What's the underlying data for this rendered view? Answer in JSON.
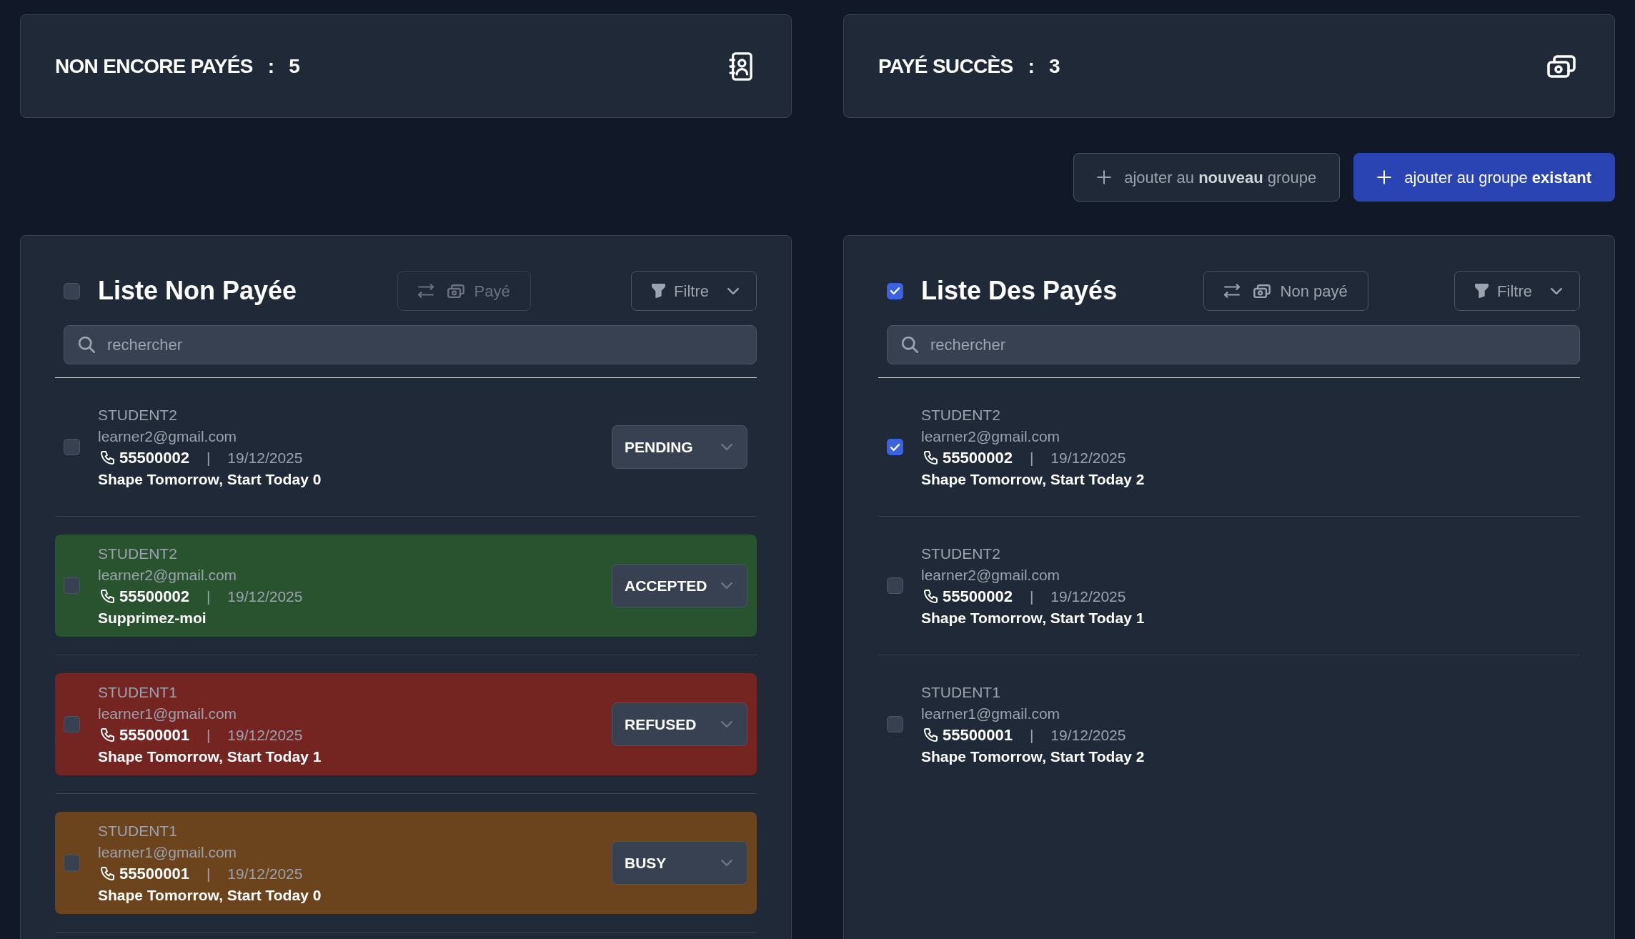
{
  "summary_cards": [
    {
      "kind": "unpaid",
      "label": "NON ENCORE PAYÉS",
      "separator": ":",
      "count": "5"
    },
    {
      "kind": "paid",
      "label": "PAYÉ SUCCÈS",
      "separator": ":",
      "count": "3"
    }
  ],
  "group_buttons": [
    {
      "kind": "secondary",
      "label": "ajouter au **nouveau** groupe"
    },
    {
      "kind": "primary",
      "label": "ajouter au groupe **existant**"
    }
  ],
  "lists": [
    {
      "all_checked": false,
      "title": "Liste Non Payée",
      "move_button": {
        "label": "Payé",
        "disabled": true
      },
      "filter_button": {
        "label": "Filtre"
      },
      "search": {
        "placeholder": "rechercher"
      },
      "more_below": true,
      "items": [
        {
          "checked": false,
          "name": "STUDENT2",
          "email": "learner2@gmail.com",
          "phone": "55500002",
          "separator": "|",
          "date": "19/12/2025",
          "subtitle": "Shape Tomorrow, Start Today 0",
          "status": "PENDING"
        },
        {
          "checked": false,
          "color": "#29532f",
          "name": "STUDENT2",
          "email": "learner2@gmail.com",
          "phone": "55500002",
          "separator": "|",
          "date": "19/12/2025",
          "subtitle": "Supprimez-moi",
          "status": "ACCEPTED"
        },
        {
          "checked": false,
          "color": "#742522",
          "name": "STUDENT1",
          "email": "learner1@gmail.com",
          "phone": "55500001",
          "separator": "|",
          "date": "19/12/2025",
          "subtitle": "Shape Tomorrow, Start Today 1",
          "status": "REFUSED"
        },
        {
          "checked": false,
          "color": "#6b431d",
          "name": "STUDENT1",
          "email": "learner1@gmail.com",
          "phone": "55500001",
          "separator": "|",
          "date": "19/12/2025",
          "subtitle": "Shape Tomorrow, Start Today 0",
          "status": "BUSY"
        }
      ]
    },
    {
      "all_checked": true,
      "title": "Liste Des Payés",
      "move_button": {
        "label": "Non payé",
        "disabled": false
      },
      "filter_button": {
        "label": "Filtre"
      },
      "search": {
        "placeholder": "rechercher"
      },
      "items": [
        {
          "checked": true,
          "name": "STUDENT2",
          "email": "learner2@gmail.com",
          "phone": "55500002",
          "separator": "|",
          "date": "19/12/2025",
          "subtitle": "Shape Tomorrow, Start Today 2"
        },
        {
          "checked": false,
          "name": "STUDENT2",
          "email": "learner2@gmail.com",
          "phone": "55500002",
          "separator": "|",
          "date": "19/12/2025",
          "subtitle": "Shape Tomorrow, Start Today 1"
        },
        {
          "checked": false,
          "name": "STUDENT1",
          "email": "learner1@gmail.com",
          "phone": "55500001",
          "separator": "|",
          "date": "19/12/2025",
          "subtitle": "Shape Tomorrow, Start Today 2"
        }
      ]
    }
  ]
}
